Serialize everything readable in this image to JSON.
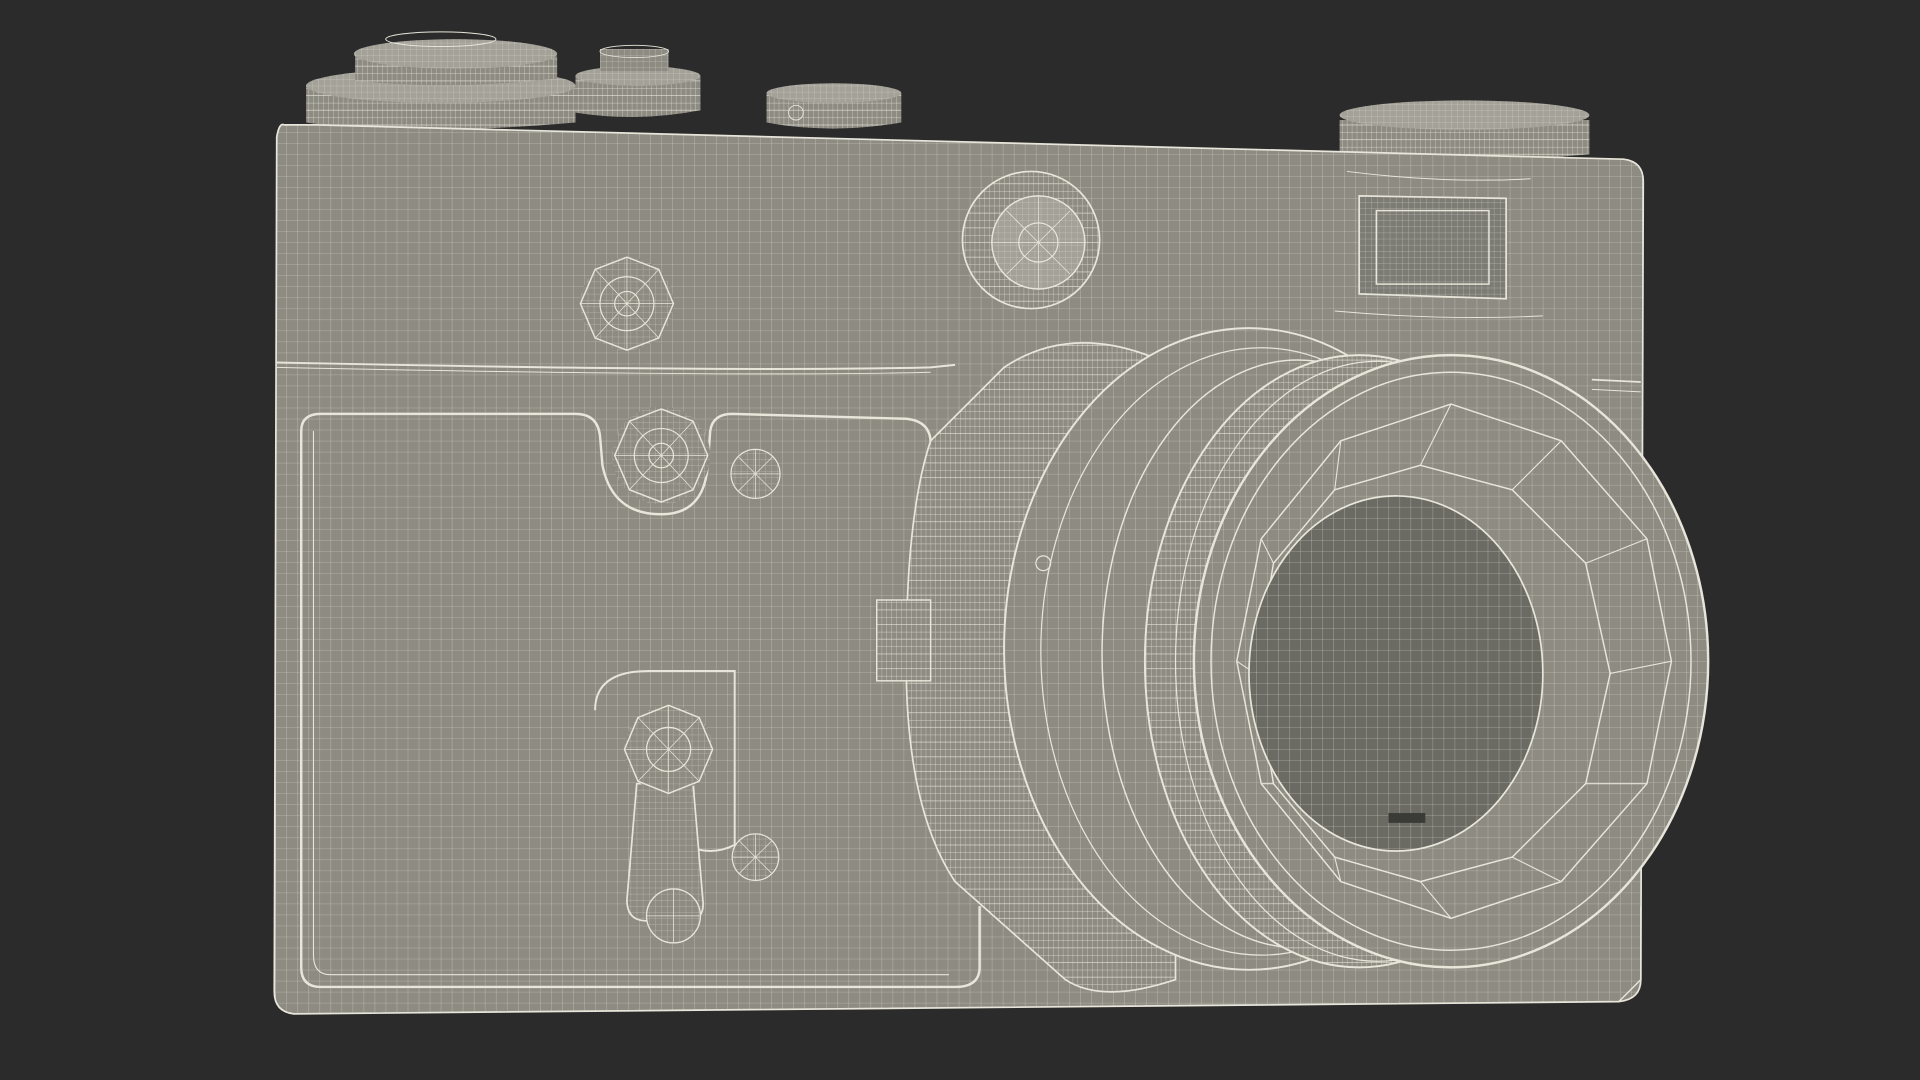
{
  "scene": {
    "subject": "camera",
    "render_style": "wireframe",
    "colors": {
      "background": "#2b2b2b",
      "body": "#8d8b82",
      "body_dark": "#74736b",
      "body_light": "#a3a198",
      "wire": "#e8e6da",
      "lens_inner": "#6b6a63"
    }
  }
}
